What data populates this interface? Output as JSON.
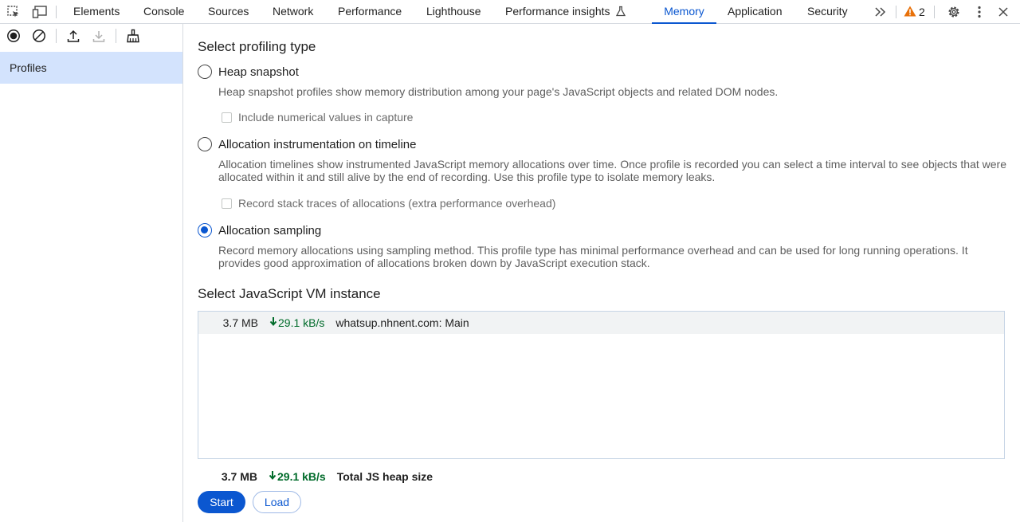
{
  "tabs": [
    {
      "label": "Elements"
    },
    {
      "label": "Console"
    },
    {
      "label": "Sources"
    },
    {
      "label": "Network"
    },
    {
      "label": "Performance"
    },
    {
      "label": "Lighthouse"
    },
    {
      "label": "Performance insights"
    },
    {
      "label": "Memory",
      "active": true
    },
    {
      "label": "Application"
    },
    {
      "label": "Security"
    }
  ],
  "warnings_count": "2",
  "sidebar": {
    "items": [
      {
        "label": "Profiles"
      }
    ]
  },
  "profiling": {
    "title": "Select profiling type",
    "options": [
      {
        "label": "Heap snapshot",
        "checked": false,
        "description": "Heap snapshot profiles show memory distribution among your page's JavaScript objects and related DOM nodes.",
        "checkbox": "Include numerical values in capture"
      },
      {
        "label": "Allocation instrumentation on timeline",
        "checked": false,
        "description": "Allocation timelines show instrumented JavaScript memory allocations over time. Once profile is recorded you can select a time interval to see objects that were allocated within it and still alive by the end of recording. Use this profile type to isolate memory leaks.",
        "checkbox": "Record stack traces of allocations (extra performance overhead)"
      },
      {
        "label": "Allocation sampling",
        "checked": true,
        "description": "Record memory allocations using sampling method. This profile type has minimal performance overhead and can be used for long running operations. It provides good approximation of allocations broken down by JavaScript execution stack."
      }
    ]
  },
  "vm": {
    "title": "Select JavaScript VM instance",
    "instances": [
      {
        "size": "3.7 MB",
        "rate": "29.1 kB/s",
        "name": "whatsup.nhnent.com: Main"
      }
    ],
    "total": {
      "size": "3.7 MB",
      "rate": "29.1 kB/s",
      "label": "Total JS heap size"
    }
  },
  "buttons": {
    "start": "Start",
    "load": "Load"
  },
  "colors": {
    "accent": "#0b57d0",
    "selected_bg": "#d3e3fd",
    "rate_green": "#006b2a",
    "warning": "#e8710a"
  }
}
